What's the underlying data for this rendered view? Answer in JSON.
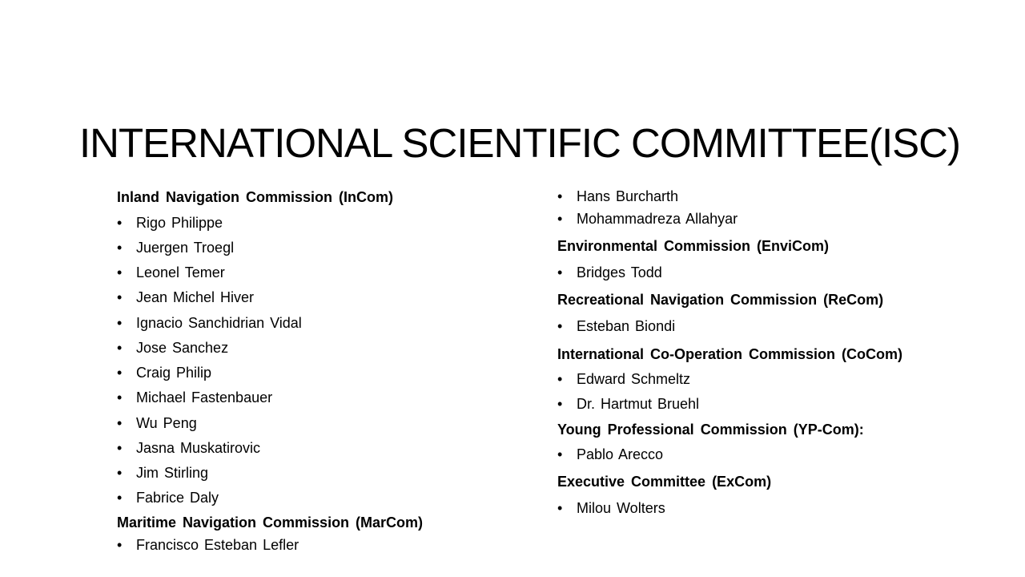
{
  "title": "INTERNATIONAL SCIENTIFIC COMMITTEE(ISC)",
  "bullet_glyph": "•",
  "left_column": {
    "heading_1": "Inland Navigation Commission (InCom)",
    "list_1": [
      "Rigo Philippe",
      "Juergen Troegl",
      "Leonel Temer",
      "Jean Michel Hiver",
      "Ignacio Sanchidrian Vidal",
      "Jose Sanchez",
      "Craig Philip",
      "Michael Fastenbauer",
      "Wu Peng",
      "Jasna Muskatirovic",
      "Jim Stirling",
      "Fabrice Daly"
    ],
    "heading_2": "Maritime Navigation Commission (MarCom)",
    "list_2": [
      "Francisco Esteban Lefler"
    ]
  },
  "right_column": {
    "list_marcom_cont": [
      "Hans Burcharth",
      "Mohammadreza Allahyar"
    ],
    "heading_envicom": "Environmental Commission (EnviCom)",
    "list_envicom": [
      "Bridges Todd"
    ],
    "heading_recom": "Recreational Navigation Commission (ReCom)",
    "list_recom": [
      "Esteban Biondi"
    ],
    "heading_cocom": "International Co-Operation Commission (CoCom)",
    "list_cocom": [
      "Edward Schmeltz",
      "Dr. Hartmut Bruehl"
    ],
    "heading_ypcom": "Young Professional Commission (YP-Com):",
    "list_ypcom": [
      "Pablo Arecco"
    ],
    "heading_excom": "Executive Committee (ExCom)",
    "list_excom": [
      "Milou Wolters"
    ]
  }
}
